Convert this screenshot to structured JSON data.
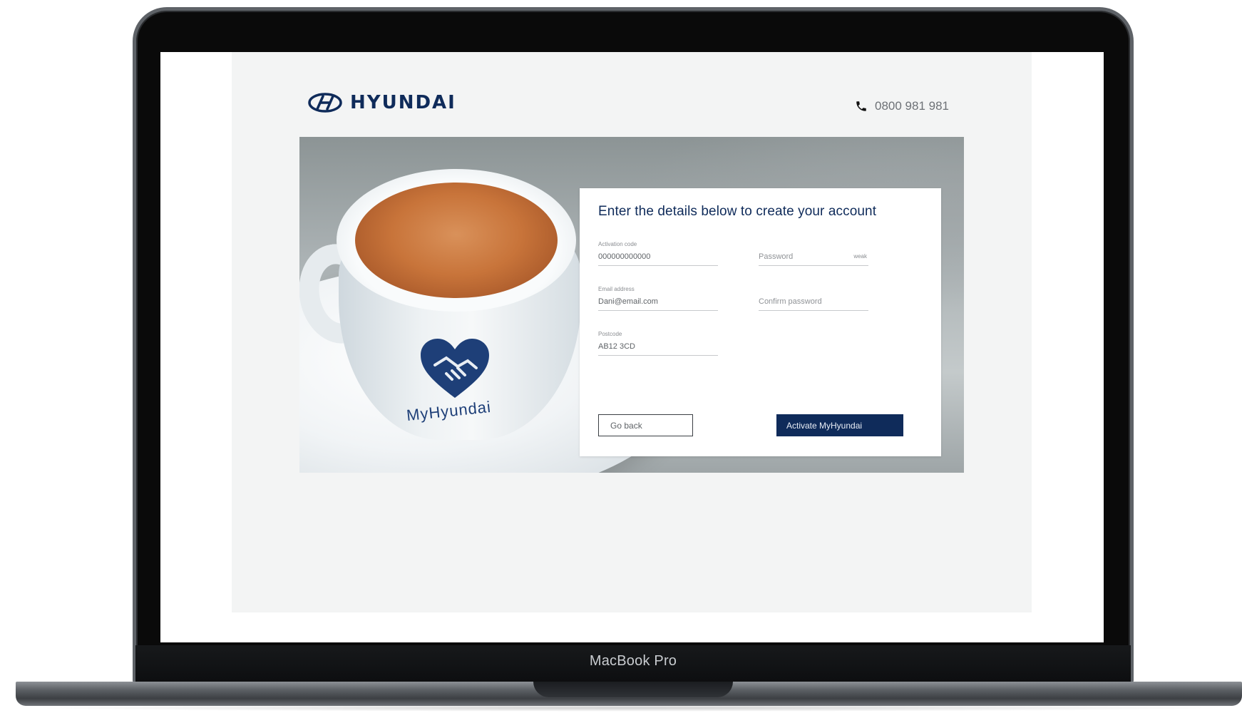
{
  "device": {
    "label": "MacBook Pro"
  },
  "header": {
    "brand": "HYUNDAI",
    "phone": "0800 981 981"
  },
  "hero": {
    "cup_brand": "MyHyundai"
  },
  "form": {
    "title": "Enter the details below to create your account",
    "activation_code": {
      "label": "Activation code",
      "value": "000000000000"
    },
    "email": {
      "label": "Email address",
      "value": "Dani@email.com"
    },
    "postcode": {
      "label": "Postcode",
      "value": "AB12 3CD"
    },
    "password": {
      "placeholder": "Password",
      "strength": "weak"
    },
    "confirm_password": {
      "placeholder": "Confirm password"
    },
    "back_button": "Go back",
    "submit_button": "Activate MyHyundai"
  },
  "colors": {
    "brand_navy": "#0f2b5a",
    "page_bg": "#f3f4f4"
  },
  "icons": {
    "logo": "hyundai-logo-icon",
    "phone": "phone-icon",
    "heart": "heart-handshake-icon"
  }
}
